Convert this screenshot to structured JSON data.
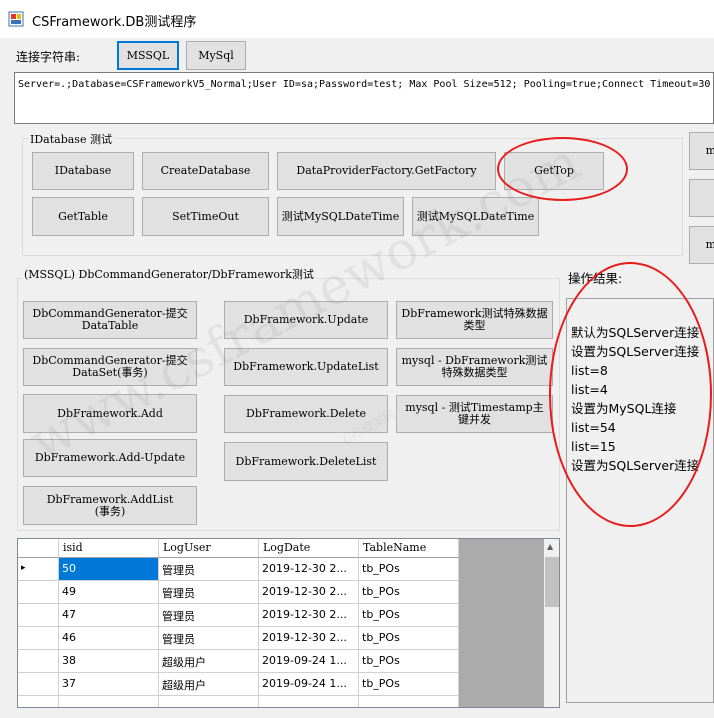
{
  "window": {
    "title": "CSFramework.DB测试程序"
  },
  "conn": {
    "label": "连接字符串:",
    "mssql_button": "MSSQL",
    "mysql_button": "MySql",
    "value": "Server=.;Database=CSFrameworkV5_Normal;User ID=sa;Password=test; Max Pool Size=512; Pooling=true;Connect Timeout=30"
  },
  "idb": {
    "group_label": "IDatabase 测试",
    "buttons": [
      "IDatabase",
      "CreateDatabase",
      "DataProviderFactory.GetFactory",
      "GetTop",
      "GetTable",
      "SetTimeOut",
      "测试MySQLDateTime",
      "测试MySQLDateTime"
    ],
    "side_buttons": [
      "m",
      "",
      "m"
    ]
  },
  "dbcmd": {
    "group_label": "(MSSQL) DbCommandGenerator/DbFramework测试",
    "buttons": [
      "DbCommandGenerator-提交\nDataTable",
      "DbCommandGenerator-提交\nDataSet(事务)",
      "DbFramework.Add",
      "DbFramework.Add-Update",
      "DbFramework.AddList\n(事务)",
      "DbFramework.Update",
      "DbFramework.UpdateList",
      "DbFramework.Delete",
      "DbFramework.DeleteList",
      "DbFramework测试特殊数据\n类型",
      "mysql - DbFramework测试\n特殊数据类型",
      "mysql - 测试Timestamp主\n键并发"
    ]
  },
  "result": {
    "label": "操作结果:",
    "lines": [
      "默认为SQLServer连接",
      "设置为SQLServer连接",
      "list=8",
      "list=4",
      "设置为MySQL连接",
      "list=54",
      "list=15",
      "设置为SQLServer连接"
    ]
  },
  "grid": {
    "columns": [
      "isid",
      "LogUser",
      "LogDate",
      "TableName"
    ],
    "rows": [
      [
        "50",
        "管理员",
        "2019-12-30 2...",
        "tb_POs"
      ],
      [
        "49",
        "管理员",
        "2019-12-30 2...",
        "tb_POs"
      ],
      [
        "47",
        "管理员",
        "2019-12-30 2...",
        "tb_POs"
      ],
      [
        "46",
        "管理员",
        "2019-12-30 2...",
        "tb_POs"
      ],
      [
        "38",
        "超级用户",
        "2019-09-24 1...",
        "tb_POs"
      ],
      [
        "37",
        "超级用户",
        "2019-09-24 1...",
        "tb_POs"
      ]
    ],
    "current_row_marker": "▸"
  },
  "watermark": {
    "main": "www.csframework.com",
    "sub": "C/S框架网"
  },
  "colors": {
    "annotation": "#e81c1c",
    "selection": "#0078d7"
  }
}
